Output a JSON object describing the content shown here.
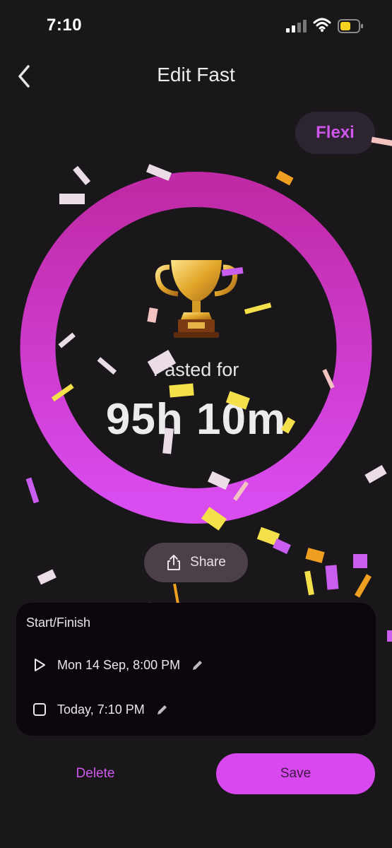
{
  "status": {
    "time": "7:10"
  },
  "nav": {
    "title": "Edit Fast"
  },
  "badge": {
    "label": "Flexi"
  },
  "summary": {
    "label": "Fasted for",
    "duration": "95h 10m"
  },
  "share": {
    "label": "Share"
  },
  "start_finish": {
    "title": "Start/Finish",
    "start": "Mon 14 Sep, 8:00 PM",
    "finish": "Today, 7:10 PM"
  },
  "actions": {
    "delete_label": "Delete",
    "save_label": "Save"
  },
  "colors": {
    "background": "#1a171b",
    "accent": "#d848ef",
    "ring_top": "#c02aa6",
    "ring_bottom": "#d94cf0",
    "card": "#0c050d",
    "share_bg": "#4b3f4a"
  },
  "icons": {
    "back": "chevron-left-icon",
    "share": "share-icon",
    "start": "play-icon",
    "finish": "checkbox-icon",
    "edit": "pencil-icon",
    "trophy": "trophy-icon",
    "signal": "signal-icon",
    "wifi": "wifi-icon",
    "battery": "battery-icon"
  }
}
